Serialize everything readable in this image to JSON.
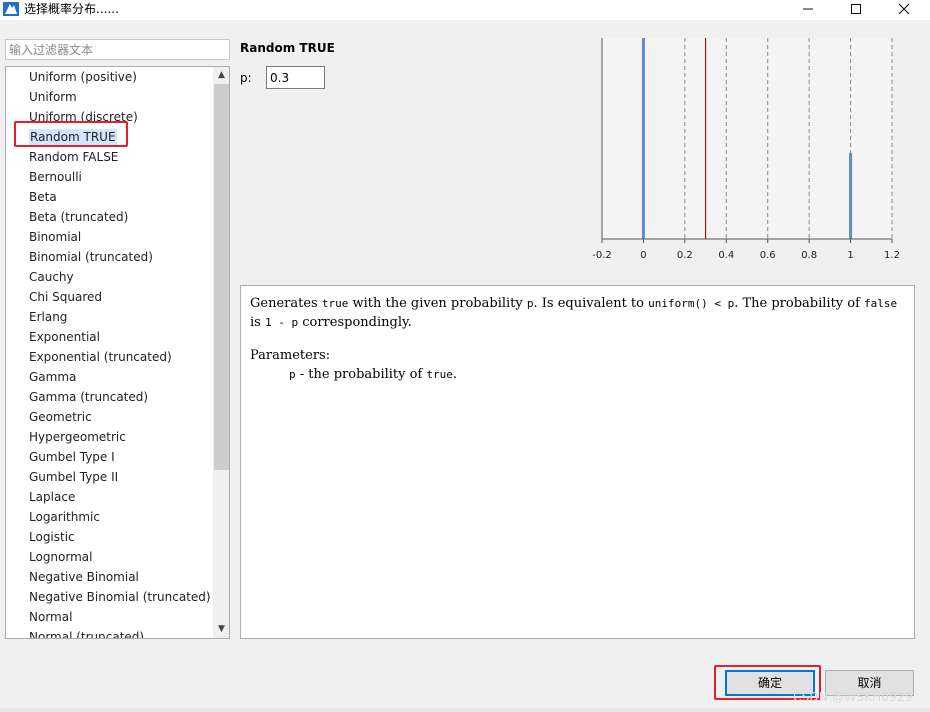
{
  "window": {
    "title": "选择概率分布......"
  },
  "filter": {
    "placeholder": "输入过滤器文本",
    "value": ""
  },
  "distributions": [
    "Uniform (positive)",
    "Uniform",
    "Uniform (discrete)",
    "Random TRUE",
    "Random FALSE",
    "Bernoulli",
    "Beta",
    "Beta (truncated)",
    "Binomial",
    "Binomial (truncated)",
    "Cauchy",
    "Chi Squared",
    "Erlang",
    "Exponential",
    "Exponential (truncated)",
    "Gamma",
    "Gamma (truncated)",
    "Geometric",
    "Hypergeometric",
    "Gumbel Type I",
    "Gumbel Type II",
    "Laplace",
    "Logarithmic",
    "Logistic",
    "Lognormal",
    "Negative Binomial",
    "Negative Binomial (truncated)",
    "Normal",
    "Normal (truncated)"
  ],
  "selected_index": 3,
  "detail": {
    "title": "Random TRUE",
    "param_label": "p:",
    "param_value": "0.3"
  },
  "chart_data": {
    "type": "bar",
    "x": [
      0,
      1
    ],
    "values": [
      0.7,
      0.3
    ],
    "marker_line": 0.3,
    "xlim": [
      -0.2,
      1.2
    ],
    "ylim": [
      0,
      0.7
    ],
    "x_ticks": [
      "-0.2",
      "0",
      "0.2",
      "0.4",
      "0.6",
      "0.8",
      "1",
      "1.2"
    ],
    "grid": "vertical dashed",
    "bar_color": "#5b8fc7",
    "marker_color": "#a01818"
  },
  "description": {
    "t1": "Generates ",
    "c1": "true",
    "t2": " with the given probability ",
    "c2": "p",
    "t3": ". Is equivalent to ",
    "c3": "uniform() < p",
    "t4": ". The probability of ",
    "c4": "false",
    "t5": " is ",
    "c5": "1 - p",
    "t6": " correspondingly.",
    "params_heading": "Parameters:",
    "param_name": "p",
    "param_desc": " - the probability of ",
    "param_code": "true",
    "param_end": "."
  },
  "buttons": {
    "ok": "确定",
    "cancel": "取消"
  },
  "watermark": "CSDN @WSKH0929"
}
